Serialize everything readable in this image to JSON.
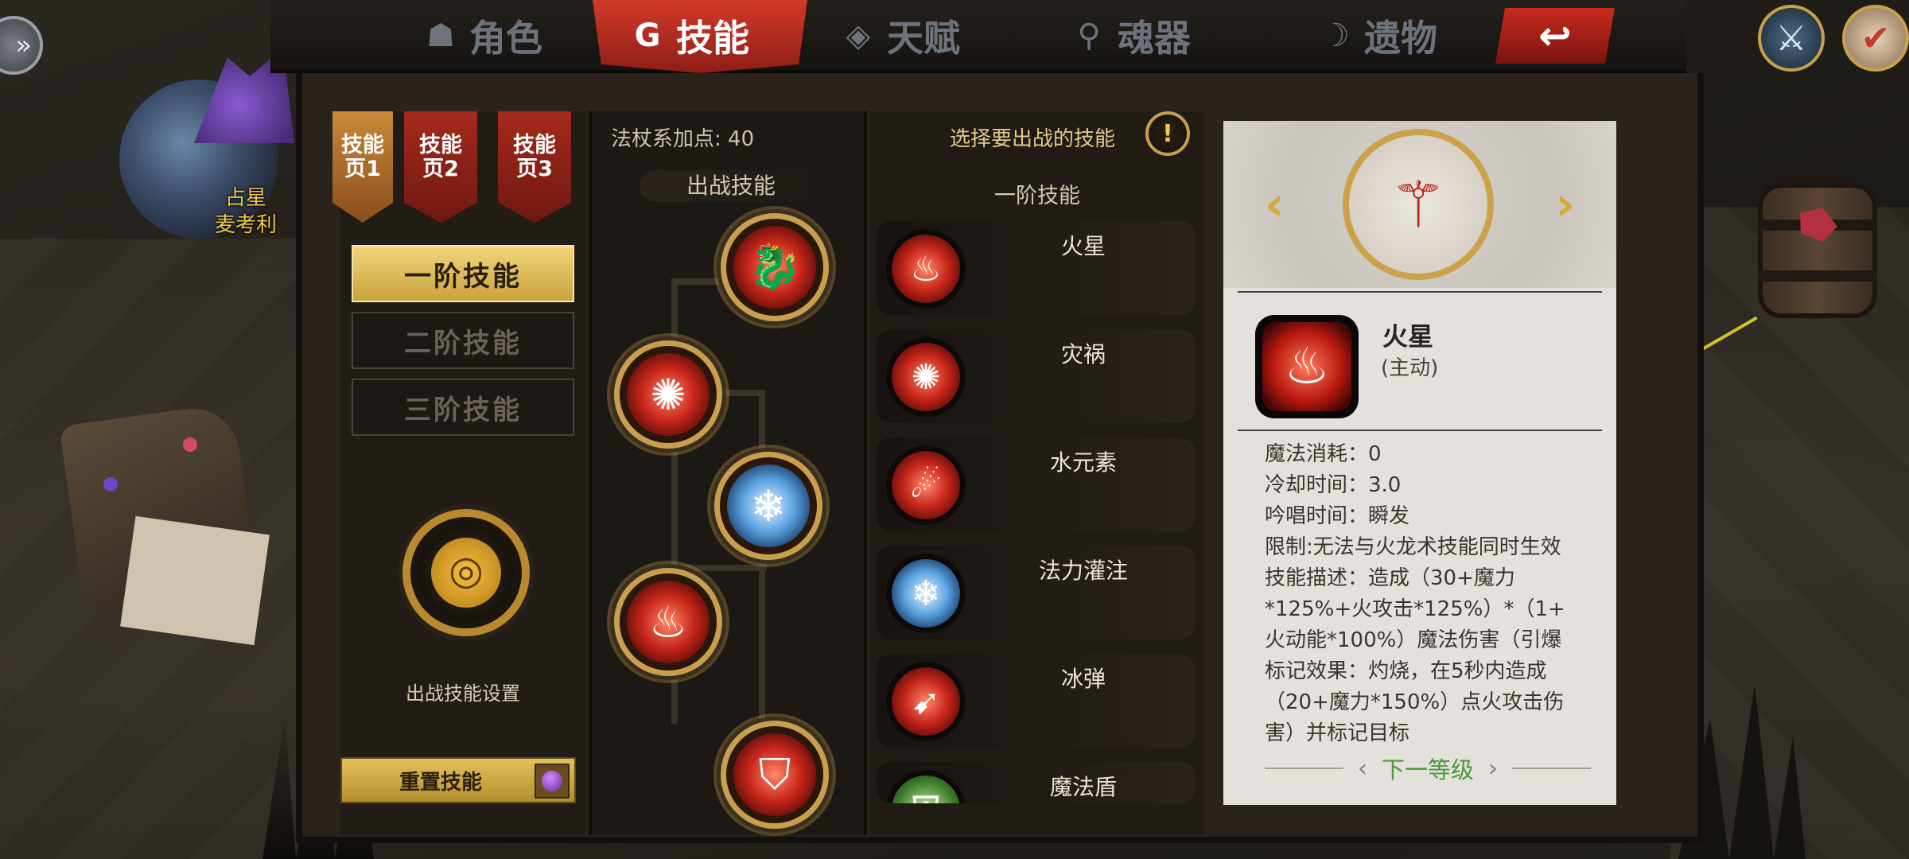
{
  "top_tabs": [
    {
      "label": "角色",
      "icon": "helmet-icon"
    },
    {
      "label": "技能",
      "icon": "skill-swirl-icon",
      "active": true
    },
    {
      "label": "天赋",
      "icon": "talent-gem-icon"
    },
    {
      "label": "魂器",
      "icon": "soul-vessel-icon"
    },
    {
      "label": "遗物",
      "icon": "relic-icon"
    }
  ],
  "back_button": {
    "icon": "return-arrow-icon",
    "glyph": "↩"
  },
  "character": {
    "label_line1": "占星",
    "label_line2": "麦考利"
  },
  "pages": [
    "技能页1",
    "技能页2",
    "技能页3"
  ],
  "pages_display": [
    {
      "line1": "技能",
      "line2": "页1"
    },
    {
      "line1": "技能",
      "line2": "页2"
    },
    {
      "line1": "技能",
      "line2": "页3"
    }
  ],
  "tiers": [
    "一阶技能",
    "二阶技能",
    "三阶技能"
  ],
  "active_tier": "一阶技能",
  "battle_settings_label": "出战技能设置",
  "reset_button": {
    "label": "重置技能",
    "cost_icon": "purple-potion-icon"
  },
  "tree": {
    "points_label": "法杖系加点: 40",
    "battle_skills_label": "出战技能",
    "nodes": [
      "beast-fire",
      "ember-orb",
      "ice-spirit",
      "flame",
      "rune-shield"
    ]
  },
  "skill_list": {
    "select_hint": "选择要出战的技能",
    "tier_title": "一阶技能",
    "items": [
      {
        "name": "火星",
        "icon": "flame-icon",
        "kind": "fire"
      },
      {
        "name": "灾祸",
        "icon": "ember-orb-icon",
        "kind": "fire"
      },
      {
        "name": "水元素",
        "icon": "water-swirl-icon",
        "kind": "fire"
      },
      {
        "name": "法力灌注",
        "icon": "mana-infusion-icon",
        "kind": "ice"
      },
      {
        "name": "冰弹",
        "icon": "ice-bolt-icon",
        "kind": "fire"
      },
      {
        "name": "魔法盾",
        "icon": "magic-shield-icon",
        "kind": "green"
      }
    ]
  },
  "detail": {
    "weapon_icon": "fire-staff-icon",
    "skill_name": "火星",
    "skill_type": "(主动)",
    "lines": [
      "魔法消耗：0",
      "冷却时间：3.0",
      "吟唱时间：瞬发",
      "限制:无法与火龙术技能同时生效",
      "技能描述：造成（30+魔力",
      "*125%+火攻击*125%）*（1+",
      "火动能*100%）魔法伤害（引爆",
      "标记效果：灼烧，在5秒内造成",
      "（20+魔力*150%）点火攻击伤",
      "害）并标记目标"
    ],
    "next_level_label": "下一等级"
  },
  "colors": {
    "active_tab": "#d23a2a",
    "gold": "#c89f4e",
    "tier_active": "#e9c868",
    "next_level": "#4a9a3a"
  }
}
